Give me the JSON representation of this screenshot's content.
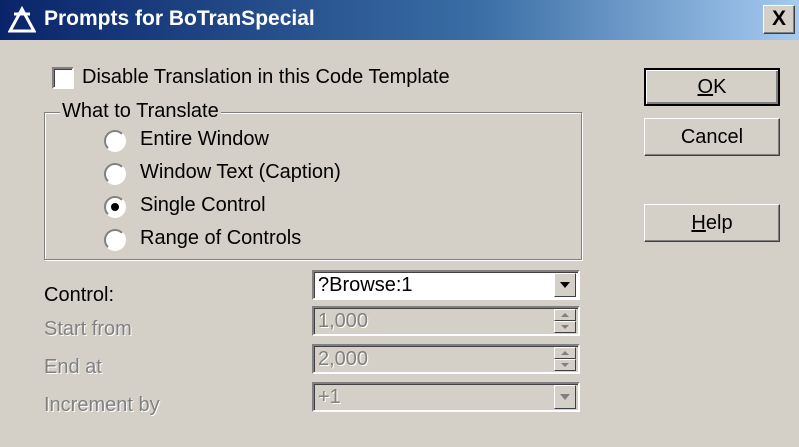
{
  "window": {
    "title": "Prompts for BoTranSpecial",
    "close_label": "X"
  },
  "options": {
    "disable_translation_label": "Disable Translation in this Code Template",
    "disable_translation_checked": false
  },
  "what_to_translate": {
    "title": "What to Translate",
    "choices": [
      "Entire Window",
      "Window Text (Caption)",
      "Single Control",
      "Range of Controls"
    ],
    "selected": "Single Control"
  },
  "fields": {
    "control": {
      "label": "Control:",
      "value": "?Browse:1"
    },
    "start_from": {
      "label": "Start from",
      "value": "1,000"
    },
    "end_at": {
      "label": "End at",
      "value": "2,000"
    },
    "increment_by": {
      "label": "Increment by",
      "value": "+1"
    }
  },
  "buttons": {
    "ok": {
      "accel": "O",
      "rest": "K"
    },
    "cancel": {
      "label": "Cancel"
    },
    "help": {
      "accel": "H",
      "rest": "elp"
    }
  }
}
